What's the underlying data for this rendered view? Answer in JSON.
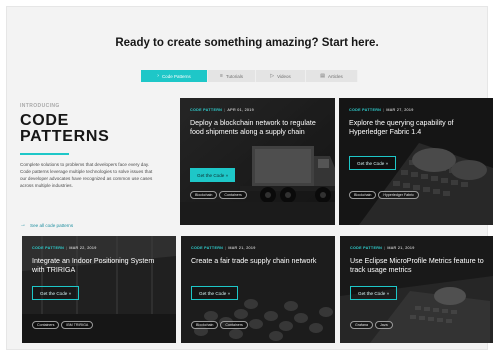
{
  "headline": "Ready to create something amazing? Start here.",
  "tabs": [
    {
      "label": "Code Patterns",
      "icon": "code-icon",
      "glyph": "›",
      "active": true
    },
    {
      "label": "Tutorials",
      "icon": "list-icon",
      "glyph": "≡",
      "active": false
    },
    {
      "label": "Videos",
      "icon": "play-icon",
      "glyph": "▷",
      "active": false
    },
    {
      "label": "Articles",
      "icon": "article-icon",
      "glyph": "▤",
      "active": false
    }
  ],
  "intro": {
    "eyebrow": "INTRODUCING",
    "title_line1": "CODE",
    "title_line2": "PATTERNS",
    "description": "Complete solutions to problems that developers face every day. Code patterns leverage multiple technologies to solve issues that our developer advocates have recognized as common use cases across multiple industries.",
    "link": "See all code patterns",
    "link_icon": "arrow-right-icon",
    "accent": "#1ec7c8"
  },
  "cards": [
    {
      "type": "CODE PATTERN",
      "date": "APR 01, 2019",
      "title": "Deploy a blockchain network to regulate food shipments along a supply chain",
      "cta": "Get the Code »",
      "tags": [
        "Blockchain",
        "Containers"
      ]
    },
    {
      "type": "CODE PATTERN",
      "date": "MAR 27, 2019",
      "title": "Explore the querying capability of Hyperledger Fabric 1.4",
      "cta": "Get the Code »",
      "tags": [
        "Blockchain",
        "Hyperledger Fabric"
      ]
    },
    {
      "type": "CODE PATTERN",
      "date": "MAR 22, 2019",
      "title": "Integrate an Indoor Positioning System with TRIRIGA",
      "cta": "Get the Code »",
      "tags": [
        "Containers",
        "IBM TRIRIGA"
      ]
    },
    {
      "type": "CODE PATTERN",
      "date": "MAR 21, 2019",
      "title": "Create a fair trade supply chain network",
      "cta": "Get the Code »",
      "tags": [
        "Blockchain",
        "Containers"
      ]
    },
    {
      "type": "CODE PATTERN",
      "date": "MAR 21, 2019",
      "title": "Use Eclipse MicroProfile Metrics feature to track usage metrics",
      "cta": "Get the Code »",
      "tags": [
        "Grafana",
        "Java"
      ]
    }
  ]
}
